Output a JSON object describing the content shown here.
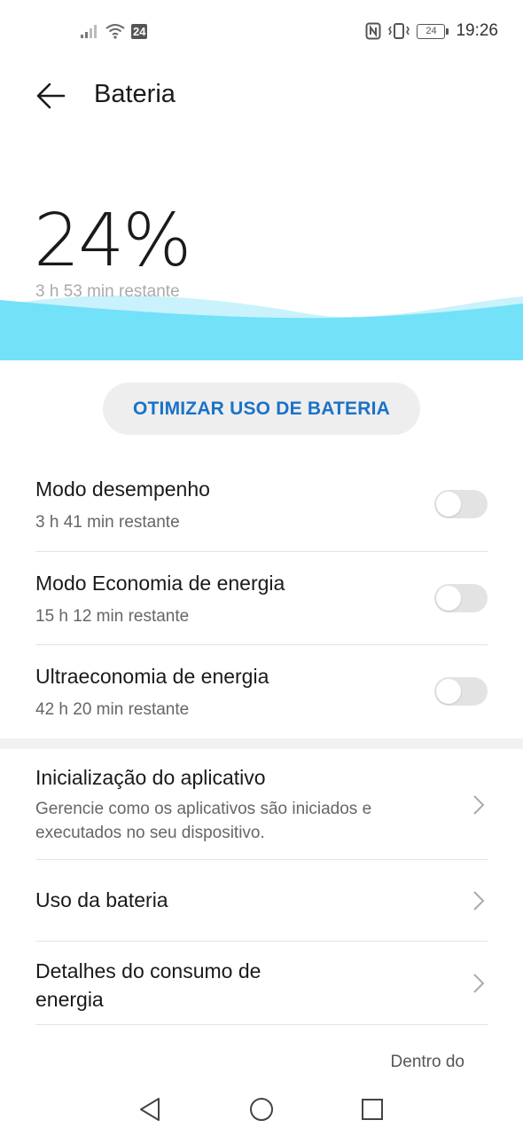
{
  "status_bar": {
    "network_badge": "24",
    "battery_level": "24",
    "time": "19:26"
  },
  "header": {
    "title": "Bateria"
  },
  "battery": {
    "percent": "24%",
    "remaining": "3 h 53 min restante",
    "wave_color": "#73e1f8"
  },
  "optimize_button": {
    "label": "OTIMIZAR USO DE BATERIA"
  },
  "modes": [
    {
      "title": "Modo desempenho",
      "subtitle": "3 h 41 min restante",
      "enabled": false
    },
    {
      "title": "Modo Economia de energia",
      "subtitle": "15 h 12 min restante",
      "enabled": false
    },
    {
      "title": "Ultraeconomia de energia",
      "subtitle": "42 h 20 min restante",
      "enabled": false
    }
  ],
  "links": [
    {
      "title": "Inicialização do aplicativo",
      "subtitle": "Gerencie como os aplicativos são iniciados e executados no seu dispositivo."
    },
    {
      "title": "Uso da bateria"
    },
    {
      "title": "Detalhes do consumo de energia"
    }
  ],
  "footer_note": "Dentro do",
  "icons": {
    "back": "arrow-left",
    "signal": "signal-bars",
    "wifi": "wifi",
    "nfc": "nfc",
    "vibrate": "vibrate",
    "battery": "battery",
    "chevron": "chevron-right",
    "nav_back": "triangle-left",
    "nav_home": "circle",
    "nav_recents": "square"
  }
}
